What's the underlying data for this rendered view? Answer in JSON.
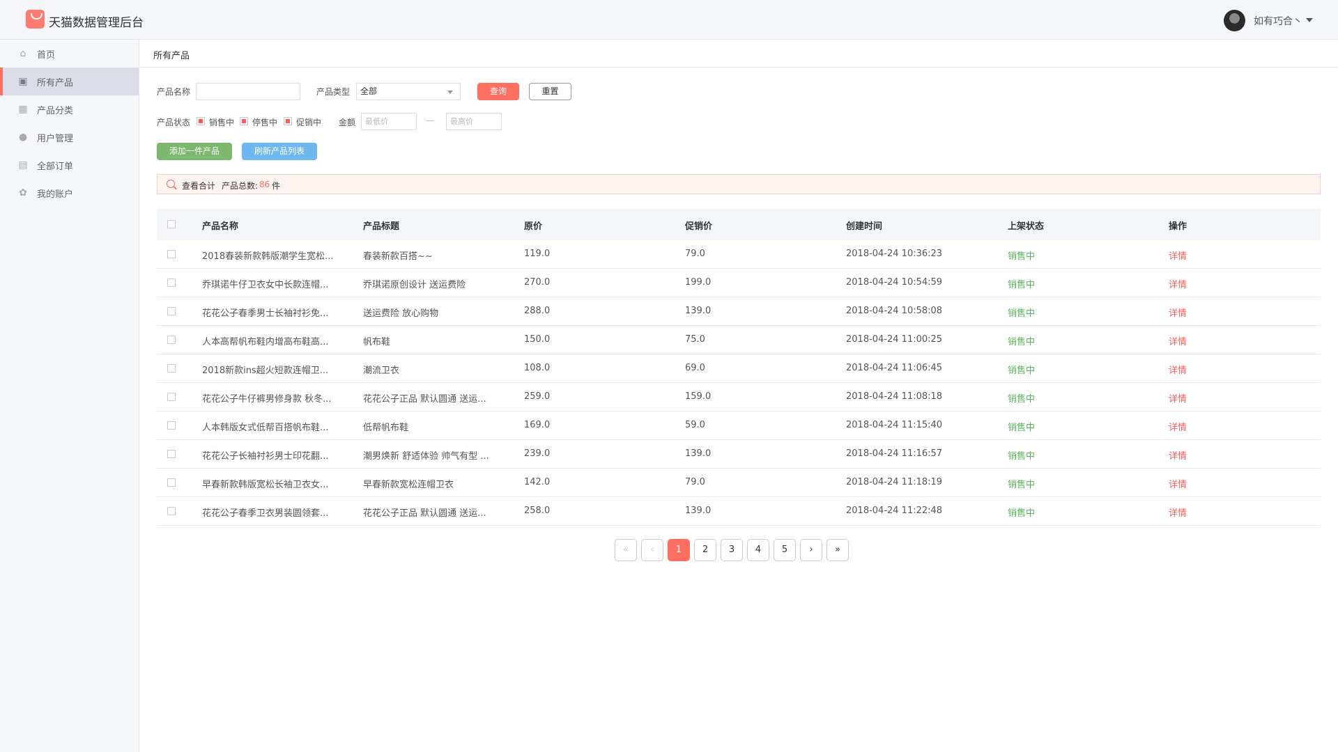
{
  "header": {
    "title": "天猫数据管理后台",
    "user_name": "如有巧合丶"
  },
  "sidebar": {
    "items": [
      {
        "label": "首页",
        "icon": "home-icon",
        "active": false
      },
      {
        "label": "所有产品",
        "icon": "product-icon",
        "active": true
      },
      {
        "label": "产品分类",
        "icon": "category-icon",
        "active": false
      },
      {
        "label": "用户管理",
        "icon": "user-icon",
        "active": false
      },
      {
        "label": "全部订单",
        "icon": "order-icon",
        "active": false
      },
      {
        "label": "我的账户",
        "icon": "gear-icon",
        "active": false
      }
    ]
  },
  "page": {
    "breadcrumb": "所有产品"
  },
  "filters": {
    "name_label": "产品名称",
    "name_value": "",
    "type_label": "产品类型",
    "type_value": "全部",
    "query_label": "查询",
    "reset_label": "重置",
    "status_label": "产品状态",
    "status_options": [
      "销售中",
      "停售中",
      "促销中"
    ],
    "amount_label": "金额",
    "min_placeholder": "最低价",
    "range_sep": "—",
    "max_placeholder": "最高价"
  },
  "actions": {
    "add_label": "添加一件产品",
    "refresh_label": "刷新产品列表"
  },
  "summary": {
    "view_total": "查看合计",
    "total_label": "产品总数:",
    "total_count": "86",
    "unit": "件"
  },
  "table": {
    "columns": [
      "产品名称",
      "产品标题",
      "原价",
      "促销价",
      "创建时间",
      "上架状态",
      "操作"
    ],
    "rows": [
      {
        "name": "2018春装新款韩版潮学生宽松...",
        "title": "春装新款百搭~~",
        "price": "119.0",
        "promo": "79.0",
        "created": "2018-04-24 10:36:23",
        "status": "销售中",
        "action": "详情"
      },
      {
        "name": "乔琪诺牛仔卫衣女中长款连帽...",
        "title": "乔琪诺原创设计 送运费险",
        "price": "270.0",
        "promo": "199.0",
        "created": "2018-04-24 10:54:59",
        "status": "销售中",
        "action": "详情"
      },
      {
        "name": "花花公子春季男士长袖衬衫免...",
        "title": "送运费险 放心购物",
        "price": "288.0",
        "promo": "139.0",
        "created": "2018-04-24 10:58:08",
        "status": "销售中",
        "action": "详情"
      },
      {
        "name": "人本高帮帆布鞋内增高布鞋高...",
        "title": "帆布鞋",
        "price": "150.0",
        "promo": "75.0",
        "created": "2018-04-24 11:00:25",
        "status": "销售中",
        "action": "详情"
      },
      {
        "name": "2018新款ins超火短款连帽卫...",
        "title": "潮流卫衣",
        "price": "108.0",
        "promo": "69.0",
        "created": "2018-04-24 11:06:45",
        "status": "销售中",
        "action": "详情"
      },
      {
        "name": "花花公子牛仔裤男修身款 秋冬...",
        "title": "花花公子正品 默认圆通 送运...",
        "price": "259.0",
        "promo": "159.0",
        "created": "2018-04-24 11:08:18",
        "status": "销售中",
        "action": "详情"
      },
      {
        "name": "人本韩版女式低帮百搭帆布鞋...",
        "title": "低帮帆布鞋",
        "price": "169.0",
        "promo": "59.0",
        "created": "2018-04-24 11:15:40",
        "status": "销售中",
        "action": "详情"
      },
      {
        "name": "花花公子长袖衬衫男士印花翻...",
        "title": "潮男焕新 舒适体验 帅气有型 ...",
        "price": "239.0",
        "promo": "139.0",
        "created": "2018-04-24 11:16:57",
        "status": "销售中",
        "action": "详情"
      },
      {
        "name": "早春新款韩版宽松长袖卫衣女...",
        "title": "早春新款宽松连帽卫衣",
        "price": "142.0",
        "promo": "79.0",
        "created": "2018-04-24 11:18:19",
        "status": "销售中",
        "action": "详情"
      },
      {
        "name": "花花公子春季卫衣男装圆领套...",
        "title": "花花公子正品 默认圆通 送运...",
        "price": "258.0",
        "promo": "139.0",
        "created": "2018-04-24 11:22:48",
        "status": "销售中",
        "action": "详情"
      }
    ]
  },
  "pagination": {
    "first": "«",
    "prev": "‹",
    "pages": [
      "1",
      "2",
      "3",
      "4",
      "5"
    ],
    "current": "1",
    "next": "›",
    "last": "»"
  },
  "colors": {
    "accent": "#ff6f61",
    "status_green": "#5bb55b",
    "add_button": "#7cb86e",
    "refresh_button": "#6fb8ef"
  }
}
